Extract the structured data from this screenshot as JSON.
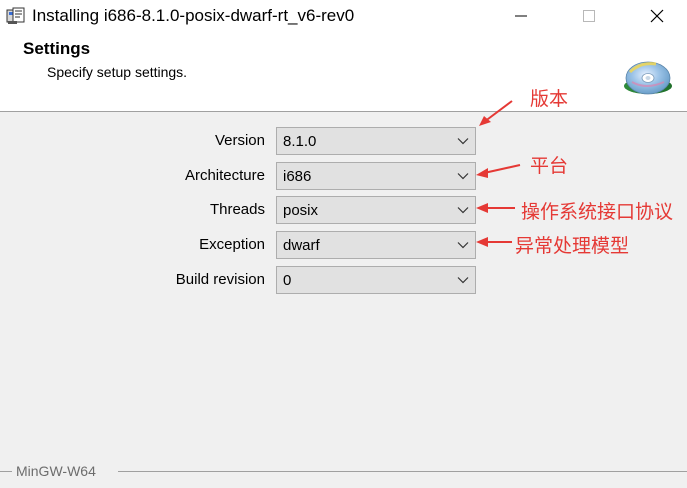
{
  "window": {
    "title": "Installing i686-8.1.0-posix-dwarf-rt_v6-rev0",
    "icon": "installer-icon"
  },
  "header": {
    "title": "Settings",
    "subtitle": "Specify setup settings.",
    "icon": "cd-icon"
  },
  "form": {
    "fields": [
      {
        "label": "Version",
        "value": "8.1.0"
      },
      {
        "label": "Architecture",
        "value": "i686"
      },
      {
        "label": "Threads",
        "value": "posix"
      },
      {
        "label": "Exception",
        "value": "dwarf"
      },
      {
        "label": "Build revision",
        "value": "0"
      }
    ]
  },
  "annotations": {
    "color": "#e53935",
    "items": [
      {
        "text": "版本"
      },
      {
        "text": "平台"
      },
      {
        "text": "操作系统接口协议"
      },
      {
        "text": "异常处理模型"
      }
    ]
  },
  "footer": {
    "brand": "MinGW-W64",
    "brand_color": "#6d6d6d"
  }
}
